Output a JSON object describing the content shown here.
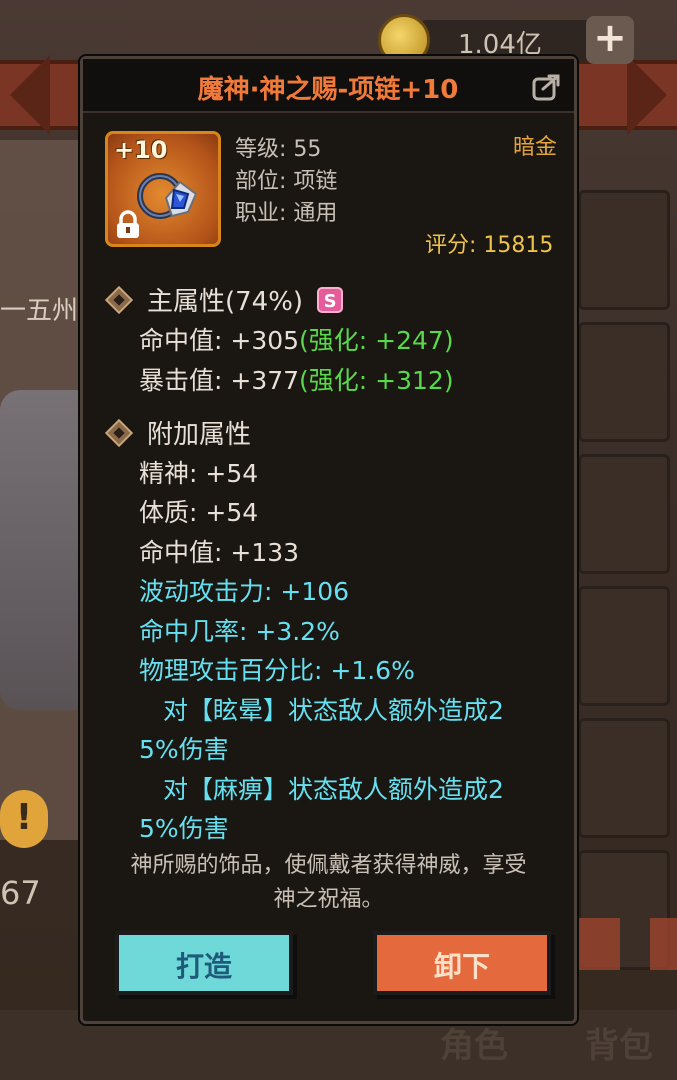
{
  "background": {
    "gold_amount": "1.04亿",
    "region_label": "一五州",
    "left_number": "67",
    "tabs": [
      "角色",
      "背包"
    ]
  },
  "item": {
    "title": "魔神·神之赐-项链+10",
    "enhance_level": "+10",
    "level": "等级: 55",
    "slot": "部位: 项链",
    "profession": "职业: 通用",
    "quality": "暗金",
    "score_label": "评分: ",
    "score_value": "15815"
  },
  "main_attr": {
    "heading": "主属性(74%)",
    "rank": "S",
    "stats": [
      {
        "base": "命中值: +305",
        "bonus": "(强化: +247)"
      },
      {
        "base": "暴击值: +377",
        "bonus": "(强化: +312)"
      }
    ]
  },
  "extra_attr": {
    "heading": "附加属性",
    "white_stats": [
      "精神: +54",
      "体质: +54",
      "命中值: +133"
    ],
    "cyan_stats": [
      "波动攻击力: +106",
      "命中几率: +3.2%",
      "物理攻击百分比: +1.6%"
    ],
    "special_effects": [
      {
        "line1": "对【眩晕】状态敌人额外造成2",
        "line2": "5%伤害"
      },
      {
        "line1": "对【麻痹】状态敌人额外造成2",
        "line2": "5%伤害"
      }
    ]
  },
  "description": {
    "line1": "神所赐的饰品，使佩戴者获得神威，享受",
    "line2": "神之祝福。"
  },
  "buttons": {
    "forge": "打造",
    "unequip": "卸下"
  },
  "colors": {
    "title": "#f07a3a",
    "quality": "#e4a53f",
    "bonus": "#58d84a",
    "special": "#66e0f0",
    "forge_button": "#6fd8d8",
    "unequip_button": "#e46a3e"
  }
}
